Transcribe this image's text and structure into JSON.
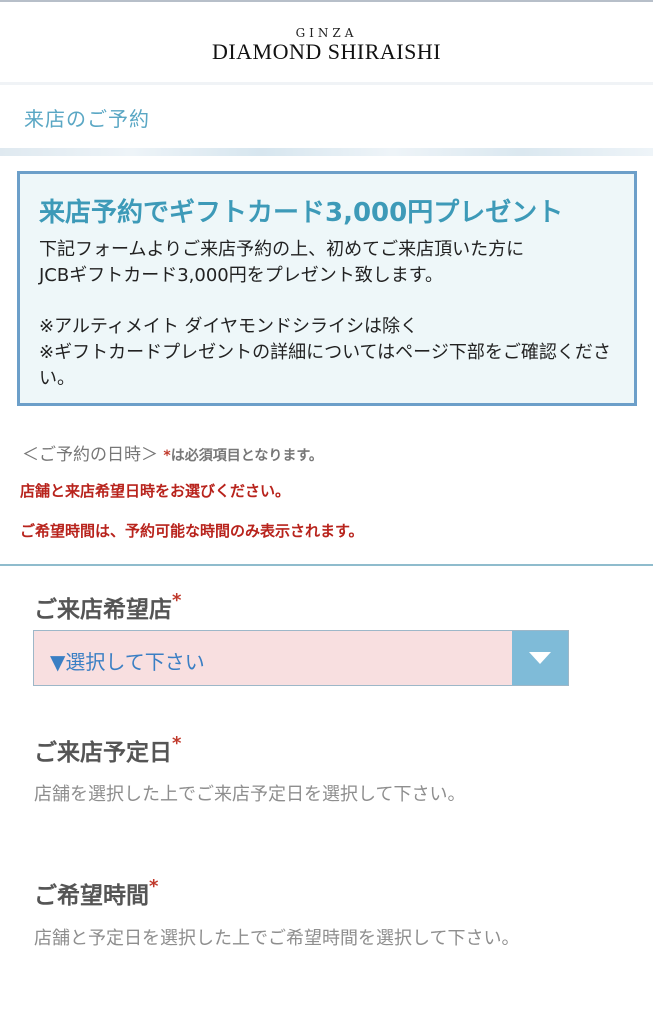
{
  "header": {
    "logo_top": "GINZA",
    "logo_main": "DIAMOND SHIRAISHI"
  },
  "section": {
    "title": "来店のご予約"
  },
  "promo": {
    "title": "来店予約でギフトカード3,000円プレゼント",
    "body_line1": "下記フォームよりご来店予約の上、初めてご来店頂いた方に",
    "body_line2": "JCBギフトカード3,000円をプレゼント致します。",
    "note1": "※アルティメイト ダイヤモンドシライシは除く",
    "note2": "※ギフトカードプレゼントの詳細についてはページ下部をご確認ください。"
  },
  "reservation": {
    "heading": "＜ご予約の日時＞",
    "required_star": "*",
    "required_note": "は必須項目となります。",
    "warning1": "店舗と来店希望日時をお選びください。",
    "warning2": "ご希望時間は、予約可能な時間のみ表示されます。"
  },
  "fields": {
    "store": {
      "label": "ご来店希望店",
      "star": "*",
      "select_value": "▼選択して下さい"
    },
    "date": {
      "label": "ご来店予定日",
      "star": "*",
      "hint": "店舗を選択した上でご来店予定日を選択して下さい。"
    },
    "time": {
      "label": "ご希望時間",
      "star": "*",
      "hint": "店舗と予定日を選択した上でご希望時間を選択して下さい。"
    }
  },
  "icons": {
    "select_arrow": "triangle-down-icon"
  },
  "colors": {
    "accent": "#3d9ab8",
    "required": "#c0392b",
    "select_bg": "#f8dfe0",
    "select_arrow_bg": "#7fbbd8"
  }
}
